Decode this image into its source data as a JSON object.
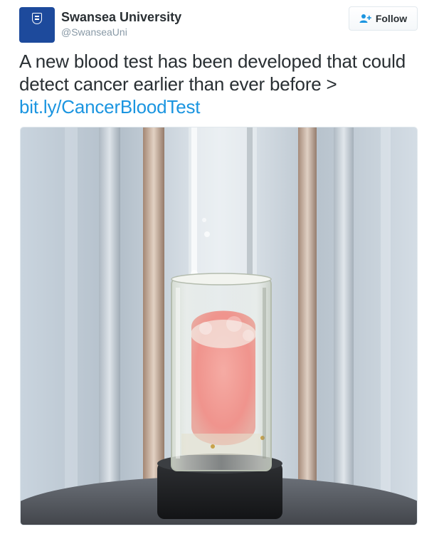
{
  "account": {
    "display_name": "Swansea University",
    "handle": "@SwanseaUni",
    "avatar_logo_text": "Swansea University Prifysgol Abertawe"
  },
  "follow_button": {
    "label": "Follow",
    "icon": "user-add-icon"
  },
  "tweet": {
    "text": "A new blood test has been developed that could detect cancer earlier than ever before >",
    "link": "bit.ly/CancerBloodTest"
  },
  "media": {
    "description_icon": "photo",
    "subject": "test-tube-with-pink-liquid"
  },
  "colors": {
    "brand_blue": "#1d4a9c",
    "link_blue": "#1b95e0",
    "text": "#292f33",
    "muted": "#8899a6"
  }
}
